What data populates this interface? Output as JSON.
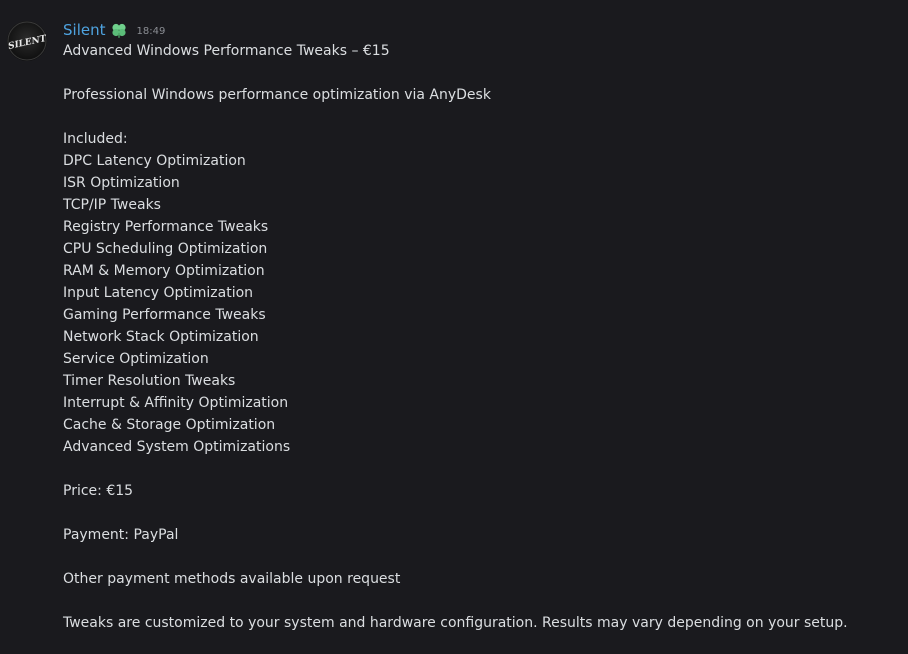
{
  "author": {
    "name": "Silent",
    "time": "18:49",
    "avatar_text": "SILENT",
    "badge_icon": "clover-icon"
  },
  "message": {
    "lines": [
      "Advanced Windows Performance Tweaks – €15",
      "",
      "Professional Windows performance optimization via AnyDesk",
      "",
      "Included:",
      "DPC Latency Optimization",
      "ISR Optimization",
      "TCP/IP Tweaks",
      "Registry Performance Tweaks",
      "CPU Scheduling Optimization",
      "RAM & Memory Optimization",
      "Input Latency Optimization",
      "Gaming Performance Tweaks",
      "Network Stack Optimization",
      "Service Optimization",
      "Timer Resolution Tweaks",
      "Interrupt & Affinity Optimization",
      "Cache & Storage Optimization",
      "Advanced System Optimizations",
      "",
      "Price: €15",
      "",
      "Payment: PayPal",
      "",
      "Other payment methods available upon request",
      "",
      "Tweaks are customized to your system and hardware configuration. Results may vary depending on your setup."
    ]
  },
  "colors": {
    "background": "#1a1a1e",
    "username": "#4ea3e0",
    "text": "#dbdee1",
    "timestamp": "#8a8d93",
    "badge": "#6fd08c"
  }
}
